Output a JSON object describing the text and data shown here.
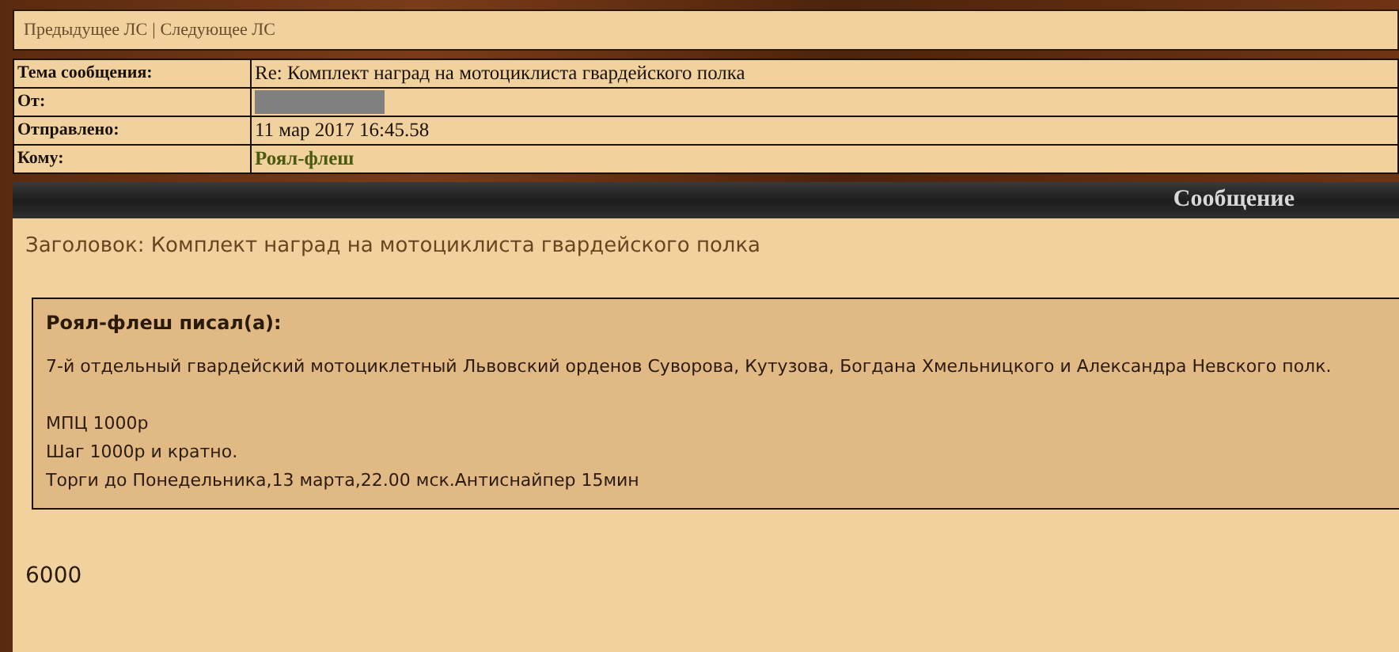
{
  "nav": {
    "links": [
      "Предыдущее ЛС",
      "Следующее ЛС"
    ],
    "separator": "|"
  },
  "header_table": {
    "rows": [
      {
        "label": "Тема сообщения:",
        "value": "Re: Комплект наград на мотоциклиста гвардейского полка",
        "kind": "text"
      },
      {
        "label": "От:",
        "kind": "redacted"
      },
      {
        "label": "Отправлено:",
        "value": "11 мар 2017 16:45.58",
        "kind": "text"
      },
      {
        "label": "Кому:",
        "value": "Роял-флеш",
        "kind": "user"
      }
    ]
  },
  "section_title": "Сообщение",
  "message": {
    "subject": "Заголовок: Комплект наград на мотоциклиста гвардейского полка",
    "quote": {
      "author": "Роял-флеш писал(а):",
      "paragraphs": [
        [
          "7-й отдельный гвардейский мотоциклетный Львовский орденов Суворова, Кутузова, Богдана Хмельницкого и Александра Невского полк."
        ],
        [
          "МПЦ 1000р",
          "Шаг 1000р и кратно.",
          "Торги до Понедельника,13 марта,22.00 мск.Антиснайпер 15мин"
        ]
      ]
    },
    "body": "6000"
  }
}
